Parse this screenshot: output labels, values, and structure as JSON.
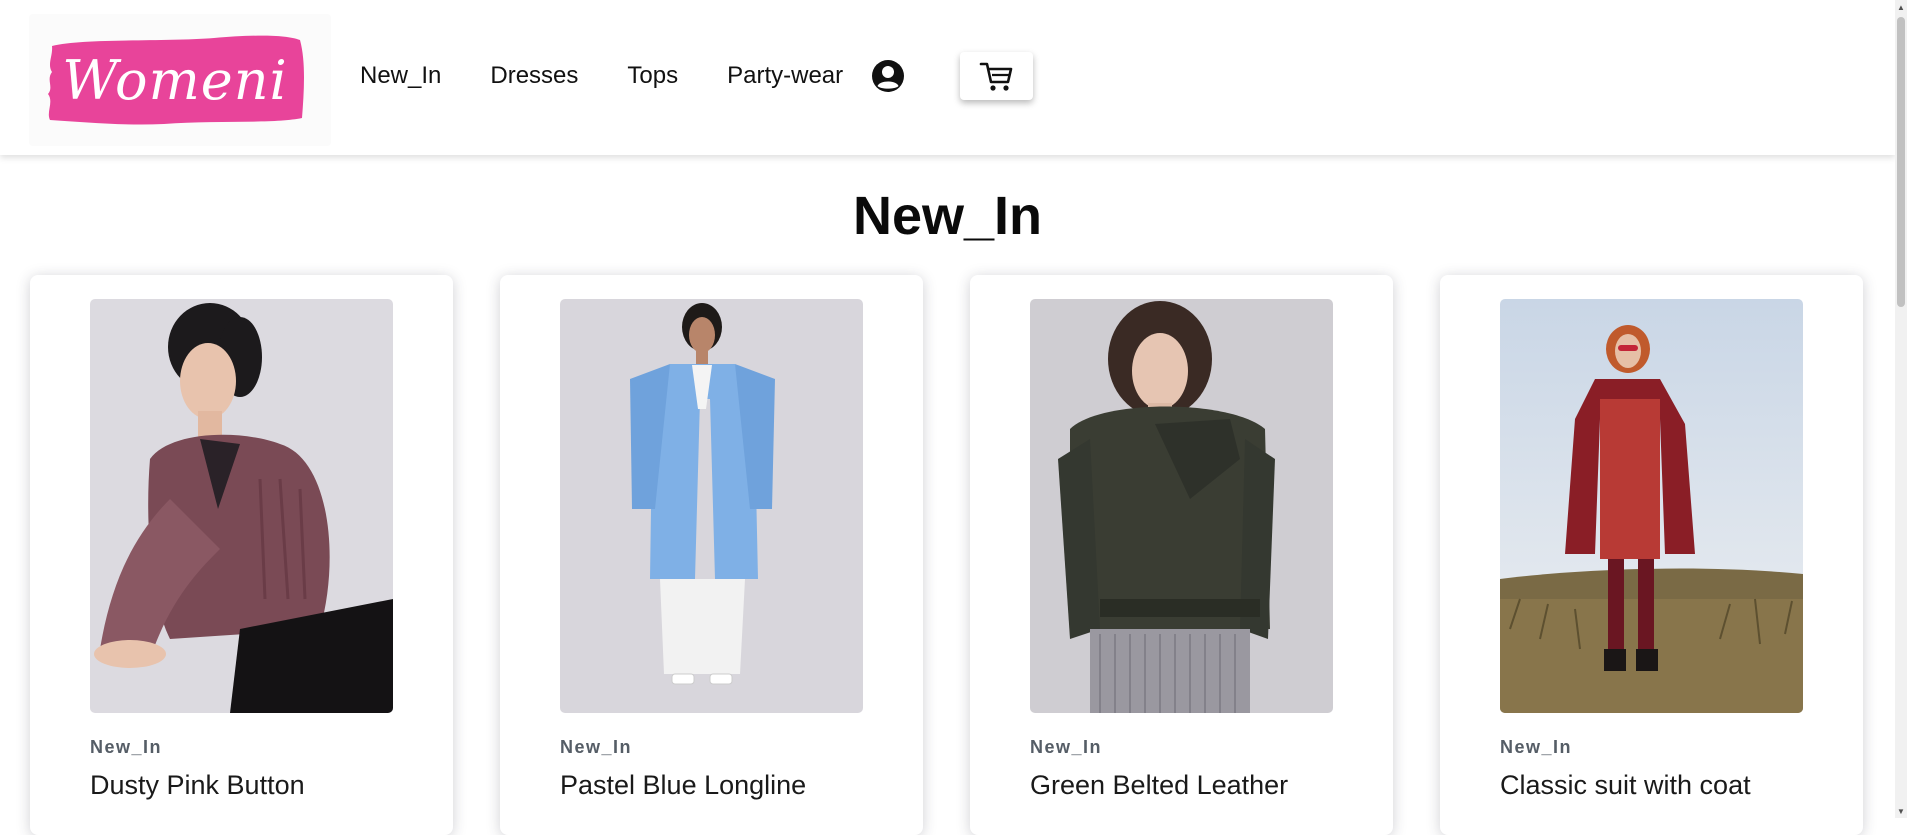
{
  "brand": {
    "logo_text": "Womeni",
    "logo_color": "#e8449a"
  },
  "nav": {
    "links": [
      {
        "label": "New_In"
      },
      {
        "label": "Dresses"
      },
      {
        "label": "Tops"
      },
      {
        "label": "Party-wear"
      }
    ],
    "account_icon": "user-circle-icon",
    "cart_icon": "shopping-cart-icon"
  },
  "page": {
    "title": "New_In"
  },
  "products": [
    {
      "category": "New_In",
      "title": "Dusty Pink Button",
      "image": "woman in dusty pink cardigan"
    },
    {
      "category": "New_In",
      "title": "Pastel Blue Longline",
      "image": "woman in pastel blue long coat"
    },
    {
      "category": "New_In",
      "title": "Green Belted Leather",
      "image": "woman in green leather jacket"
    },
    {
      "category": "New_In",
      "title": "Classic suit with coat",
      "image": "woman in red coat outdoors"
    }
  ]
}
